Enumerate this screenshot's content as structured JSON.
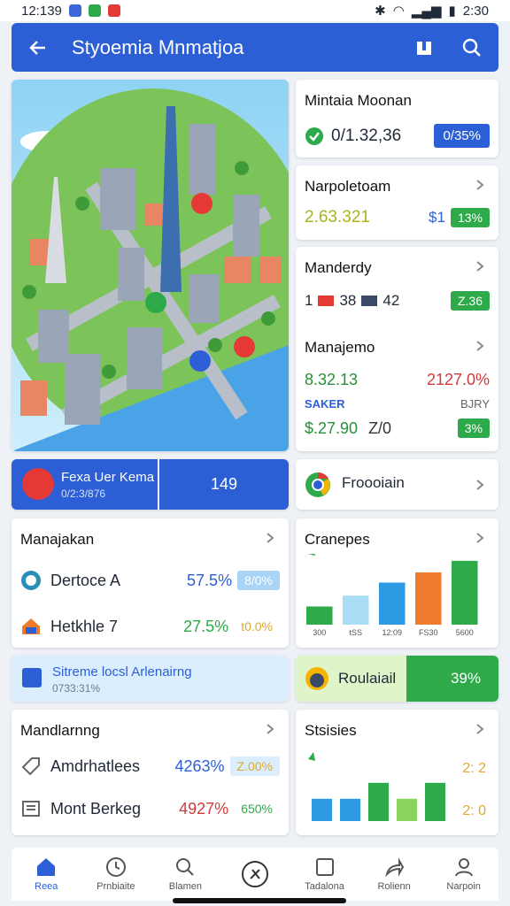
{
  "status": {
    "time": "12:139",
    "right_time": "2:30"
  },
  "appbar": {
    "title": "Styoemia Mnmatjoa"
  },
  "side_cards": [
    {
      "title": "Mintaia Moonan",
      "value": "0/1.32,36",
      "pill": "0/35%"
    },
    {
      "title": "Narpoletoam",
      "value": "2.63.321",
      "extra": "$1",
      "pill": "13%"
    },
    {
      "title": "Manderdy",
      "v1": "1",
      "v2": "38",
      "v3": "42",
      "pill": "Z.36"
    },
    {
      "title": "Manajemo",
      "value": "8.32.13",
      "right": "2127.0%",
      "sub_label": "SAKER",
      "sub_right": "BJRY",
      "value2": "$.27.90",
      "value2b": "Z/0",
      "pill": "3%"
    }
  ],
  "banner_left": {
    "title": "Fexa Uer Kema",
    "sub": "0/2:3/876",
    "value": "149"
  },
  "banner_right": {
    "label": "Froooiain"
  },
  "list1": {
    "title": "Manajakan",
    "rows": [
      {
        "label": "Dertoce A",
        "value": "57.5%",
        "pill": "8/0%"
      },
      {
        "label": "Hetkhle 7",
        "value": "27.5%",
        "pill": "t0.0%"
      }
    ]
  },
  "chart1": {
    "title": "Cranepes",
    "ticks": [
      "300",
      "tSS",
      "12:09",
      "FS30",
      "5600"
    ]
  },
  "info_banner": {
    "title": "Sitreme locsl Arlenairng",
    "sub": "0733:31%"
  },
  "progress_banner": {
    "label": "Roulaiail",
    "value": "39%"
  },
  "list2": {
    "title": "Mandlarnng",
    "rows": [
      {
        "label": "Amdrhatlees",
        "value": "4263%",
        "pill": "Z.00%"
      },
      {
        "label": "Mont Berkeg",
        "value": "4927%",
        "pill": "650%"
      }
    ]
  },
  "chart2": {
    "title": "Stsisies",
    "r1": "2: 2",
    "r2": "2: 0"
  },
  "bottom_nav": [
    "Reea",
    "Prnbiaite",
    "Blamen",
    "",
    "Tadalona",
    "Rolienn",
    "Narpoin"
  ],
  "chart_data": [
    {
      "type": "bar",
      "title": "Cranepes",
      "categories": [
        "300",
        "tSS",
        "12:09",
        "FS30",
        "5600"
      ],
      "values": [
        25,
        40,
        58,
        72,
        88
      ],
      "colors": [
        "#2eaa4a",
        "#a9dcf5",
        "#2d9ae3",
        "#f07b2c",
        "#2eaa4a"
      ],
      "ylim": [
        0,
        100
      ]
    },
    {
      "type": "bar",
      "title": "Stsisies",
      "categories": [
        "",
        "",
        "",
        "",
        ""
      ],
      "values": [
        35,
        35,
        60,
        35,
        60
      ],
      "colors": [
        "#2d9ae3",
        "#2d9ae3",
        "#2eaa4a",
        "#8bd45e",
        "#2eaa4a"
      ],
      "ylim": [
        0,
        100
      ]
    }
  ]
}
